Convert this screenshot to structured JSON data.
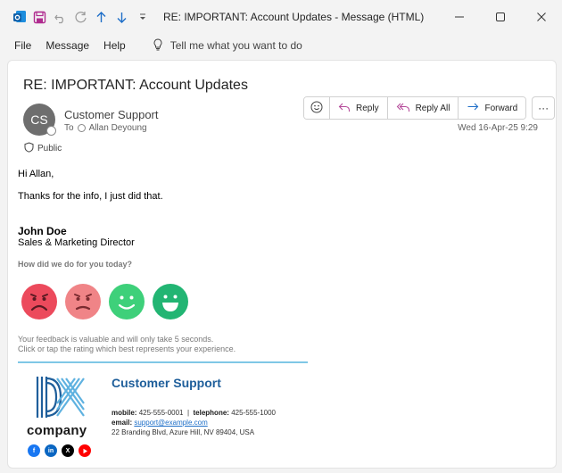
{
  "window": {
    "title": "RE: IMPORTANT: Account Updates  -  Message (HTML)"
  },
  "menu": {
    "items": [
      "File",
      "Message",
      "Help"
    ],
    "tell_me": "Tell me what you want to do"
  },
  "message": {
    "subject": "RE: IMPORTANT: Account Updates",
    "avatar_initials": "CS",
    "sender": "Customer Support",
    "to_label": "To",
    "recipient": "Allan Deyoung",
    "sensitivity": "Public",
    "date": "Wed 16-Apr-25 9:29",
    "actions": {
      "reply": "Reply",
      "reply_all": "Reply All",
      "forward": "Forward",
      "more": "···"
    }
  },
  "body": {
    "greeting": "Hi Allan,",
    "text": "Thanks for the info, I just did that.",
    "signature_name": "John Doe",
    "signature_title": "Sales & Marketing Director",
    "rating_question": "How did we do for you today?",
    "feedback_line1": "Your feedback is valuable and will only take 5 seconds.",
    "feedback_line2": "Click or tap the rating which best represents your experience."
  },
  "signature_block": {
    "company": "company",
    "title": "Customer Support",
    "mobile_label": "mobile:",
    "mobile": "425-555-0001",
    "separator": "|",
    "telephone_label": "telephone:",
    "telephone": "425-555-1000",
    "email_label": "email:",
    "email": "support@example.com",
    "address": "22 Branding Blvd, Azure Hill, NV 89404, USA"
  },
  "colors": {
    "face_very_bad": "#ec4a5c",
    "face_bad": "#f08487",
    "face_good": "#3ed07a",
    "face_great": "#22b573",
    "brand_blue": "#1f5f9b",
    "accent_divider": "#7fc7e6"
  }
}
